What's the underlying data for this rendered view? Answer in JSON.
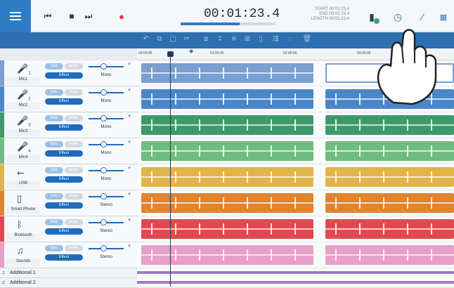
{
  "transport": {
    "time": "00:01:23.4",
    "progress": 0.62,
    "start": "START 00:01:23.4",
    "end": "END 00:01:23.4",
    "length": "LENGTH 00:01:23.4"
  },
  "colors": {
    "accent": "#2f7cc5",
    "toolbar": "#2e6fb0"
  },
  "ruler": [
    "00:00:00",
    "01:00:00",
    "02:00:00",
    "03:00:00"
  ],
  "tracks": [
    {
      "name": "Mic1",
      "icon": "mic-icon",
      "num": "1",
      "solo": "Solo",
      "mute": "Mute",
      "effect": "Effect",
      "mode": "Mono",
      "color": "#7a9fd0"
    },
    {
      "name": "Mic2",
      "icon": "mic-icon",
      "num": "2",
      "solo": "Solo",
      "mute": "Mute",
      "effect": "Effect",
      "mode": "Mono",
      "color": "#4a86c9"
    },
    {
      "name": "Mic3",
      "icon": "mic-icon",
      "num": "3",
      "solo": "Solo",
      "mute": "Mute",
      "effect": "Effect",
      "mode": "Mono",
      "color": "#3d9a6a"
    },
    {
      "name": "Mic4",
      "icon": "mic-icon",
      "num": "4",
      "solo": "Solo",
      "mute": "Mute",
      "effect": "Effect",
      "mode": "Mono",
      "color": "#6fbd7e"
    },
    {
      "name": "USB",
      "icon": "usb-icon",
      "num": "",
      "solo": "Solo",
      "mute": "Mute",
      "effect": "Effect",
      "mode": "Mono",
      "color": "#e2b54a"
    },
    {
      "name": "Smart Phone",
      "icon": "phone-icon",
      "num": "",
      "solo": "Solo",
      "mute": "Mute",
      "effect": "Effect",
      "mode": "Stereo",
      "color": "#e2832e"
    },
    {
      "name": "Bluetooth",
      "icon": "bluetooth-icon",
      "num": "",
      "solo": "Solo",
      "mute": "Mute",
      "effect": "Effect",
      "mode": "Stereo",
      "color": "#df4a4f"
    },
    {
      "name": "Sounds",
      "icon": "music-note-icon",
      "num": "",
      "solo": "Solo",
      "mute": "Mute",
      "effect": "Effect",
      "mode": "Stereo",
      "color": "#e7a0c8"
    }
  ],
  "additional": [
    "Additional 1",
    "Additional 2"
  ]
}
